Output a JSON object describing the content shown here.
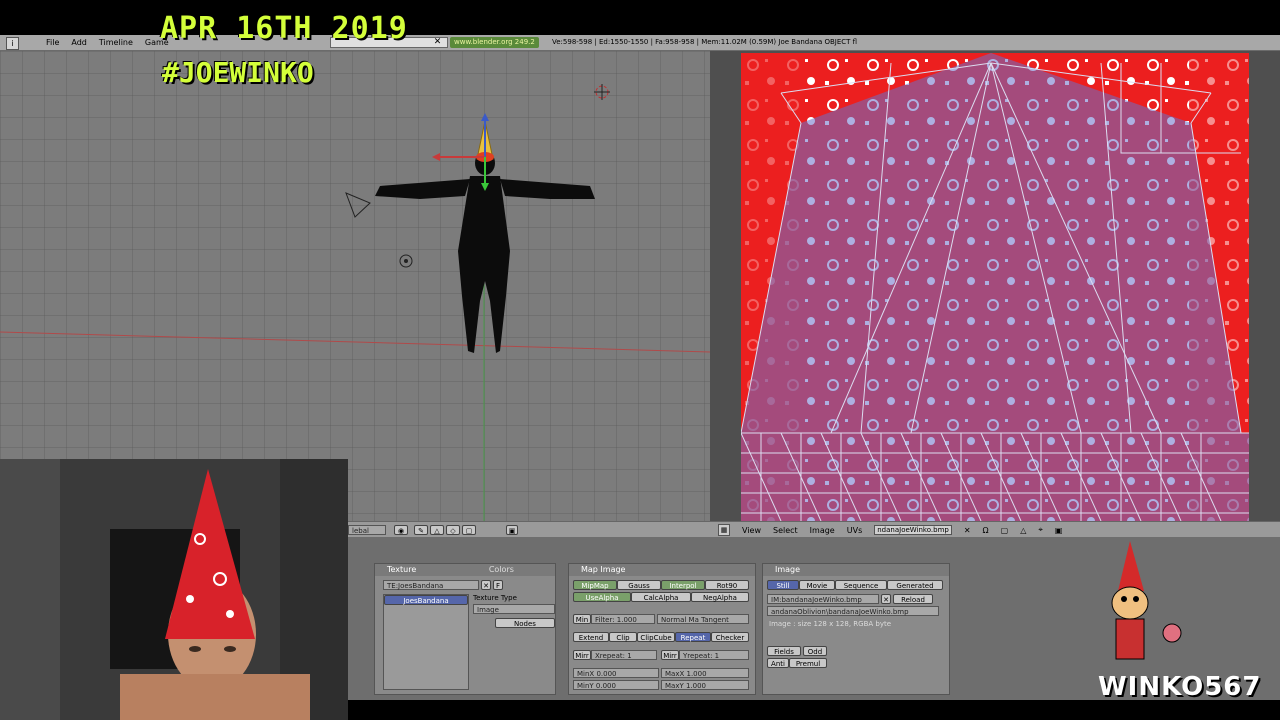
{
  "overlay": {
    "date": "APR 16TH 2019",
    "hashtag": "#JOEWINKO",
    "channel": "WINKO567"
  },
  "topbar": {
    "menu": [
      "File",
      "Add",
      "Timeline",
      "Game"
    ],
    "scene_field": "",
    "url": "www.blender.org 249.2",
    "stats": "Ve:598-598 | Ed:1550-1550 | Fa:958-958 | Mem:11.02M (0.59M) Joe Bandana OBJECT fl"
  },
  "viewport_header": {
    "mode": "lebal"
  },
  "uv_header": {
    "menu": [
      "View",
      "Select",
      "Image",
      "UVs"
    ],
    "image_name": "ndanaJoeWinko.bmp"
  },
  "panels": {
    "texture": {
      "tab_texture": "Texture",
      "tab_colors": "Colors",
      "name": "TE:JoesBandana",
      "list_item": "JoesBandana",
      "type_label": "Texture Type",
      "type_value": "Image",
      "nodes": "Nodes"
    },
    "map_image": {
      "title": "Map Image",
      "row1": [
        "MipMap",
        "Gauss",
        "Interpol",
        "Rot90"
      ],
      "row2": [
        "UseAlpha",
        "CalcAlpha",
        "NegAlpha"
      ],
      "min": "Min",
      "filter": "Filter: 1.000",
      "normal_map": "Normal Ma Tangent",
      "row4": [
        "Extend",
        "Clip",
        "ClipCube",
        "Repeat",
        "Checker"
      ],
      "mirr": "Mirr",
      "xrepeat": "Xrepeat: 1",
      "yrepeat": "Yrepeat: 1",
      "minx": "MinX 0.000",
      "maxx": "MaxX 1.000",
      "miny": "MinY 0.000",
      "maxy": "MaxY 1.000"
    },
    "image": {
      "title": "Image",
      "row1": [
        "Still",
        "Movie",
        "Sequence",
        "Generated"
      ],
      "im_name": "IM:bandanaJoeWinko.bmp",
      "reload": "Reload",
      "path": "andanaOblivion\\bandanaJoeWinko.bmp",
      "info": "Image : size 128 x 128, RGBA byte",
      "fields": "Fields",
      "odd": "Odd",
      "anti": "Anti",
      "premul": "Premul"
    }
  },
  "colors": {
    "overlay_text": "#d4ff3a",
    "image_red": "#ec1f1f",
    "blender_gray": "#a8a8a8"
  }
}
